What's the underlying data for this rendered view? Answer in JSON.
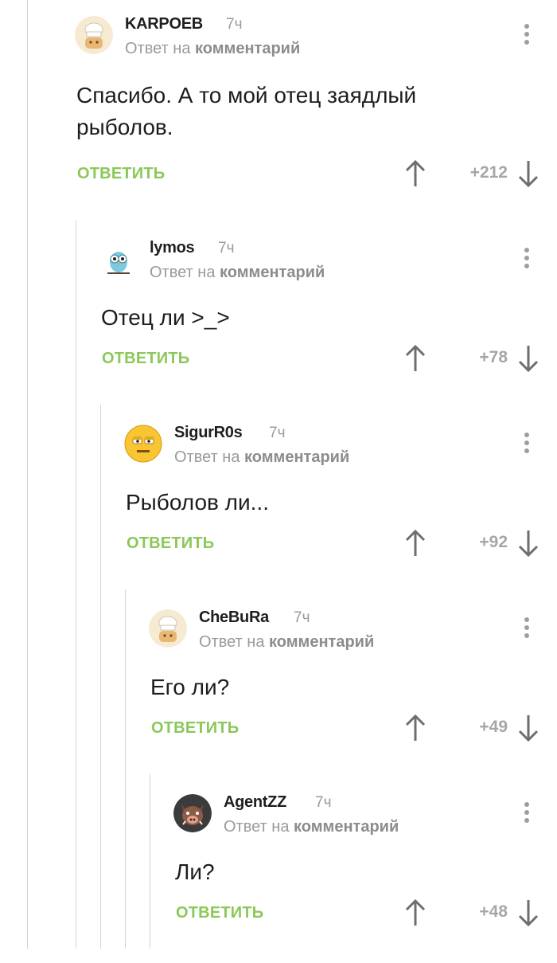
{
  "comments": [
    {
      "username": "KARPOEB",
      "time": "7ч",
      "reply_prefix": "Ответ на",
      "reply_target": "комментарий",
      "text_lines": [
        "Спасибо. А то мой отец заядлый",
        "рыболов."
      ],
      "reply_label": "ОТВЕТИТЬ",
      "score": "+212",
      "avatar": "chef-hat-avatar"
    },
    {
      "username": "lymos",
      "time": "7ч",
      "reply_prefix": "Ответ на",
      "reply_target": "комментарий",
      "text_lines": [
        "Отец ли >_>"
      ],
      "reply_label": "ОТВЕТИТЬ",
      "score": "+78",
      "avatar": "owl-avatar"
    },
    {
      "username": "SigurR0s",
      "time": "7ч",
      "reply_prefix": "Ответ на",
      "reply_target": "комментарий",
      "text_lines": [
        "Рыболов ли..."
      ],
      "reply_label": "ОТВЕТИТЬ",
      "score": "+92",
      "avatar": "smiley-avatar"
    },
    {
      "username": "CheBuRa",
      "time": "7ч",
      "reply_prefix": "Ответ на",
      "reply_target": "комментарий",
      "text_lines": [
        "Его ли?"
      ],
      "reply_label": "ОТВЕТИТЬ",
      "score": "+49",
      "avatar": "chef-hat-avatar"
    },
    {
      "username": "AgentZZ",
      "time": "7ч",
      "reply_prefix": "Ответ на",
      "reply_target": "комментарий",
      "text_lines": [
        "Ли?"
      ],
      "reply_label": "ОТВЕТИТЬ",
      "score": "+48",
      "avatar": "boar-avatar"
    }
  ],
  "colors": {
    "reply_button": "#8ac858",
    "meta_text": "#9a9a9a",
    "thread_line": "#d4d4d4"
  }
}
